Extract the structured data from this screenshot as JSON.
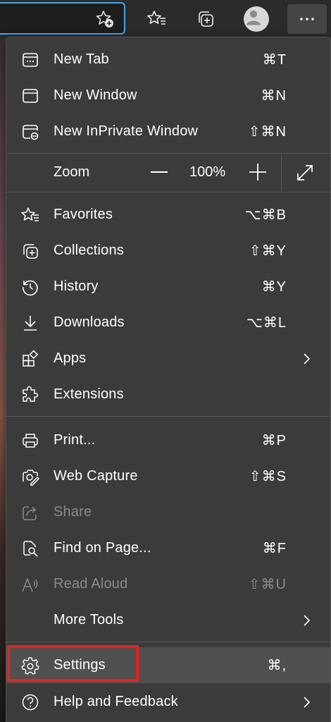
{
  "toolbar": {
    "buttons": [
      "favorites-icon",
      "collections-icon",
      "profile-avatar",
      "more-icon"
    ],
    "more_label": "···"
  },
  "menu": {
    "items": [
      {
        "label": "New Tab",
        "shortcut": "⌘T",
        "icon": "new-tab-icon"
      },
      {
        "label": "New Window",
        "shortcut": "⌘N",
        "icon": "new-window-icon"
      },
      {
        "label": "New InPrivate Window",
        "shortcut": "⇧⌘N",
        "icon": "inprivate-icon"
      },
      {
        "label": "Favorites",
        "shortcut": "⌥⌘B",
        "icon": "favorites-icon"
      },
      {
        "label": "Collections",
        "shortcut": "⇧⌘Y",
        "icon": "collections-icon"
      },
      {
        "label": "History",
        "shortcut": "⌘Y",
        "icon": "history-icon"
      },
      {
        "label": "Downloads",
        "shortcut": "⌥⌘L",
        "icon": "download-icon"
      },
      {
        "label": "Apps",
        "shortcut": "",
        "icon": "apps-icon"
      },
      {
        "label": "Extensions",
        "shortcut": "",
        "icon": "extensions-icon"
      },
      {
        "label": "Print...",
        "shortcut": "⌘P",
        "icon": "print-icon"
      },
      {
        "label": "Web Capture",
        "shortcut": "⇧⌘S",
        "icon": "web-capture-icon"
      },
      {
        "label": "Share",
        "shortcut": "",
        "icon": "share-icon"
      },
      {
        "label": "Find on Page...",
        "shortcut": "⌘F",
        "icon": "find-icon"
      },
      {
        "label": "Read Aloud",
        "shortcut": "⇧⌘U",
        "icon": "read-aloud-icon"
      },
      {
        "label": "More Tools",
        "shortcut": "",
        "icon": ""
      },
      {
        "label": "Settings",
        "shortcut": "⌘,",
        "icon": "gear-icon"
      },
      {
        "label": "Help and Feedback",
        "shortcut": "",
        "icon": "help-icon"
      }
    ],
    "zoom": {
      "label": "Zoom",
      "value": "100%"
    }
  },
  "colors": {
    "menu_bg": "#3b3b3b",
    "highlight_bg": "#505050",
    "annotation_red": "#e52222",
    "address_focus": "#4aa3e6",
    "disabled_text": "#8c8c8c"
  }
}
